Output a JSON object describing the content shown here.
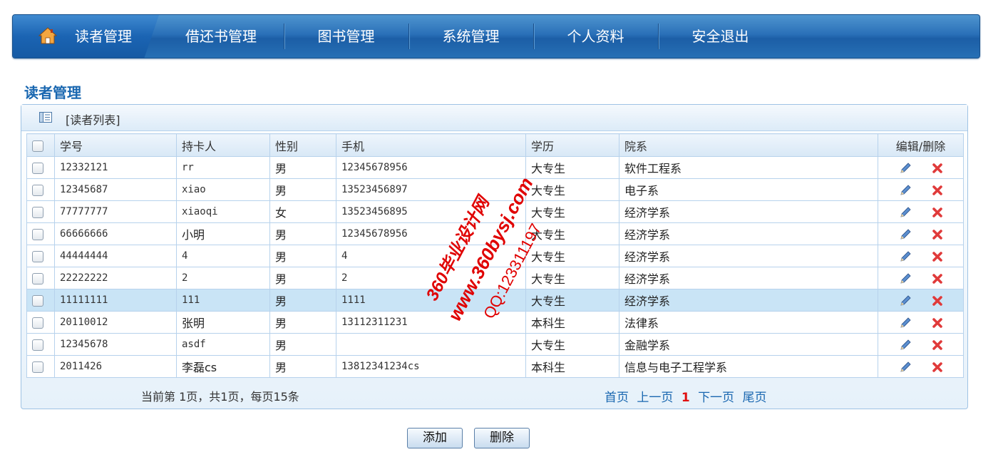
{
  "nav": {
    "items": [
      {
        "label": "读者管理",
        "active": true
      },
      {
        "label": "借还书管理"
      },
      {
        "label": "图书管理"
      },
      {
        "label": "系统管理"
      },
      {
        "label": "个人资料"
      },
      {
        "label": "安全退出"
      }
    ]
  },
  "page": {
    "title": "读者管理"
  },
  "panel": {
    "title": "[读者列表]"
  },
  "table": {
    "columns": [
      "学号",
      "持卡人",
      "性别",
      "手机",
      "学历",
      "院系",
      "编辑/删除"
    ],
    "rows": [
      [
        "12332121",
        "rr",
        "男",
        "12345678956",
        "大专生",
        "软件工程系"
      ],
      [
        "12345687",
        "xiao",
        "男",
        "13523456897",
        "大专生",
        "电子系"
      ],
      [
        "77777777",
        "xiaoqi",
        "女",
        "13523456895",
        "大专生",
        "经济学系"
      ],
      [
        "66666666",
        "小明",
        "男",
        "12345678956",
        "大专生",
        "经济学系"
      ],
      [
        "44444444",
        "4",
        "男",
        "4",
        "大专生",
        "经济学系"
      ],
      [
        "22222222",
        "2",
        "男",
        "2",
        "大专生",
        "经济学系"
      ],
      [
        "11111111",
        "111",
        "男",
        "1111",
        "大专生",
        "经济学系"
      ],
      [
        "20110012",
        "张明",
        "男",
        "13112311231",
        "本科生",
        "法律系"
      ],
      [
        "12345678",
        "asdf",
        "男",
        "",
        "大专生",
        "金融学系"
      ],
      [
        "2011426",
        "李磊cs",
        "男",
        "13812341234cs",
        "本科生",
        "信息与电子工程学系"
      ]
    ],
    "highlighted_row": 6
  },
  "pager": {
    "summary": "当前第 1页，共1页，每页15条",
    "first": "首页",
    "prev": "上一页",
    "current": "1",
    "next": "下一页",
    "last": "尾页"
  },
  "buttons": {
    "add": "添加",
    "delete": "删除"
  },
  "watermark": {
    "line1": "360毕业设计网",
    "line2": "www.360bysj.com",
    "line3": "QQ:123311197"
  },
  "colors": {
    "nav": "#2670b5",
    "title": "#1967b0",
    "link": "#1967b0",
    "current_page": "#e01010",
    "highlight": "#c9e4f6",
    "watermark": "#e00000"
  }
}
